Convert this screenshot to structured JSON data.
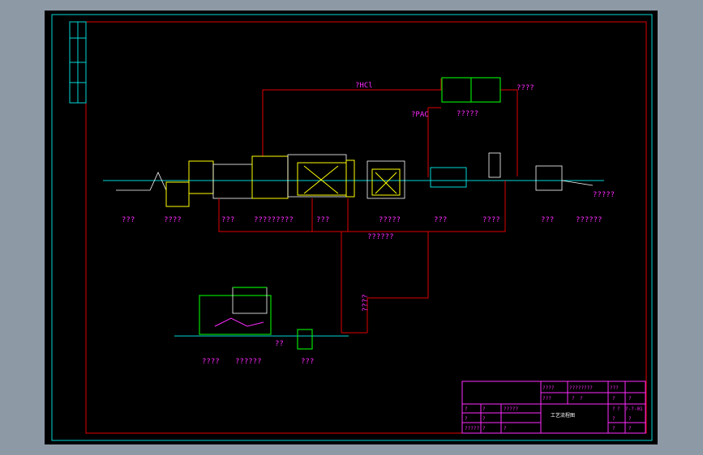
{
  "top_labels": {
    "hcl": "?HCl",
    "pac": "?PAC",
    "right_top": "????",
    "tank_top": "?????"
  },
  "mid_pipe_label": "??????",
  "vertical_pipe_label": "????",
  "right_small": "?????",
  "unit_labels": [
    "???",
    "????",
    "???",
    "?????????",
    "???",
    "?????",
    "???",
    "????",
    "???",
    "??????"
  ],
  "bottom_labels": [
    "????",
    "??????",
    "??",
    "???"
  ],
  "title_block": {
    "row1": [
      "????",
      "????????",
      "???"
    ],
    "row2": [
      "???",
      "?",
      "?",
      "?",
      "?"
    ],
    "row3": [
      "?",
      "?",
      "?????",
      "?",
      "?",
      "?-?-01"
    ],
    "row4": [
      "?",
      "?",
      "?",
      "?"
    ],
    "row5": [
      "?????",
      "?",
      "?",
      "?",
      "?"
    ],
    "drawing_name": "工艺流程图"
  },
  "colors": {
    "border": "#00d6d6",
    "frame": "#e00000",
    "text": "#ff2bff",
    "structure": "#00e000"
  }
}
